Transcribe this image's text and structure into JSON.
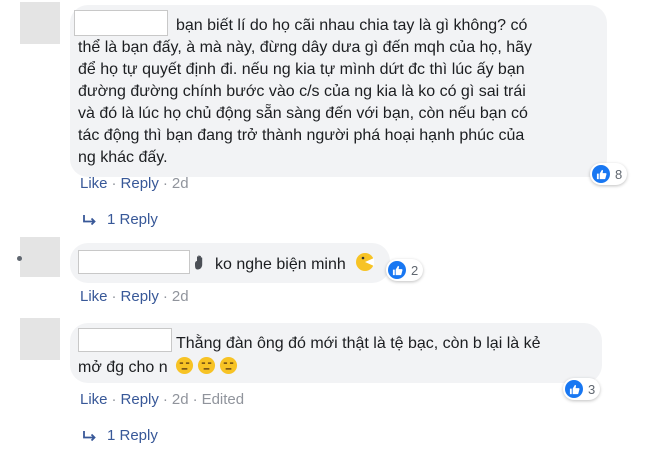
{
  "comments": [
    {
      "lines": [
        "bạn biết lí do họ cãi nhau chia tay là gì không? có",
        "thể là bạn đấy, à mà này, đừng dây dưa gì đến mqh của họ, hãy",
        "để họ tự quyết định đi. nếu ng kia tự mình dứt đc thì lúc ấy bạn",
        "đường đường chính bước vào c/s của ng kia là ko có gì sai trái",
        "và đó là lúc họ chủ động sẵn sàng đến với bạn, còn nếu bạn có",
        "tác động thì bạn đang trở thành người phá hoại hạnh phúc của",
        "ng khác đấy."
      ],
      "reaction_count": "8",
      "like_label": "Like",
      "reply_label": "Reply",
      "time": "2d",
      "replies_label": "1 Reply"
    },
    {
      "text": "ko nghe biện minh",
      "reaction_count": "2",
      "like_label": "Like",
      "reply_label": "Reply",
      "time": "2d"
    },
    {
      "lines": [
        "Thằng đàn ông đó mới thật là tệ bạc, còn b lại là kẻ",
        "mở đg cho n"
      ],
      "reaction_count": "3",
      "like_label": "Like",
      "reply_label": "Reply",
      "time": "2d",
      "edited_label": "Edited",
      "replies_label": "1 Reply"
    }
  ],
  "colors": {
    "link": "#385898",
    "meta_grey": "#90949c",
    "like_blue": "#1877f2",
    "bubble": "#f2f3f5"
  }
}
